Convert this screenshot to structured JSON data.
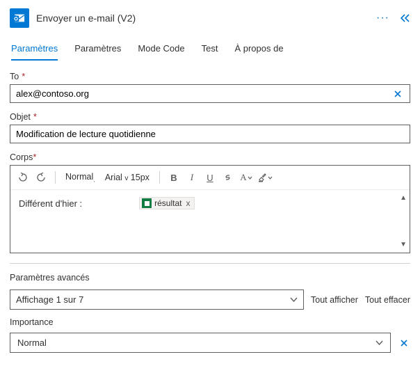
{
  "header": {
    "title": "Envoyer un e-mail (V2)"
  },
  "tabs": {
    "parametres": "Paramètres",
    "parametres2": "Paramètres",
    "modecode": "Mode Code",
    "test": "Test",
    "apropos": "À propos de"
  },
  "fields": {
    "to_label": "To",
    "to_value": "alex@contoso.org",
    "subject_label": "Objet",
    "subject_value": "Modification de lecture quotidienne",
    "body_label": "Corps"
  },
  "toolbar": {
    "style": "Normal",
    "font": "Arial",
    "caret": "v",
    "size": "15px",
    "bold": "B",
    "italic": "I",
    "underline": "U"
  },
  "body": {
    "prefix": "Différent d'hier :",
    "token_label": "résultat",
    "token_close": "x"
  },
  "advanced": {
    "label": "Paramètres avancés",
    "display": "Affichage 1 sur 7",
    "show_all": "Tout afficher",
    "clear_all": "Tout effacer"
  },
  "importance": {
    "label": "Importance",
    "value": "Normal"
  },
  "required": "*"
}
